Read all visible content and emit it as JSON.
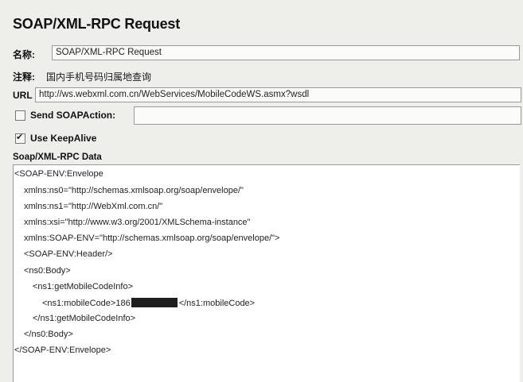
{
  "title": "SOAP/XML-RPC Request",
  "name_field": {
    "label": "名称:",
    "value": "SOAP/XML-RPC Request"
  },
  "comment_field": {
    "label": "注释:",
    "value": "国内手机号码归属地查询"
  },
  "url_field": {
    "label": "URL",
    "value": "http://ws.webxml.com.cn/WebServices/MobileCodeWS.asmx?wsdl"
  },
  "send_soapaction": {
    "label": "Send SOAPAction:",
    "checked": false,
    "value": ""
  },
  "use_keepalive": {
    "label": "Use KeepAlive",
    "checked": true
  },
  "data_section": {
    "label": "Soap/XML-RPC Data",
    "lines": [
      "<SOAP-ENV:Envelope",
      "xmlns:ns0=\"http://schemas.xmlsoap.org/soap/envelope/\"",
      "xmlns:ns1=\"http://WebXml.com.cn/\"",
      "xmlns:xsi=\"http://www.w3.org/2001/XMLSchema-instance\"",
      "xmlns:SOAP-ENV=\"http://schemas.xmlsoap.org/soap/envelope/\">",
      "<SOAP-ENV:Header/>",
      "<ns0:Body>",
      "<ns1:getMobileCodeInfo>",
      "<ns1:mobileCode>186",
      "</ns1:mobileCode>",
      "</ns1:getMobileCodeInfo>",
      "</ns0:Body>",
      "</SOAP-ENV:Envelope>"
    ]
  }
}
